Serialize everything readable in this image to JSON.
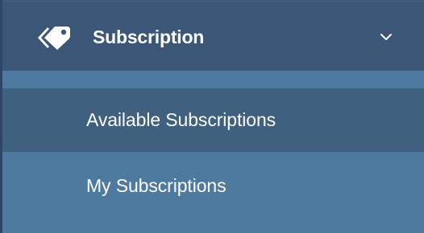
{
  "nav": {
    "group": {
      "label": "Subscription",
      "icon": "tags-icon",
      "expanded": true,
      "toggle_icon": "chevron-down-icon"
    },
    "items": [
      {
        "label": "Available Subscriptions",
        "active": true
      },
      {
        "label": "My Subscriptions",
        "active": false
      }
    ]
  },
  "colors": {
    "header_bg": "#3b5677",
    "active_item_bg": "#40607f",
    "menu_bg": "#4f7aa0",
    "text": "#ffffff"
  }
}
